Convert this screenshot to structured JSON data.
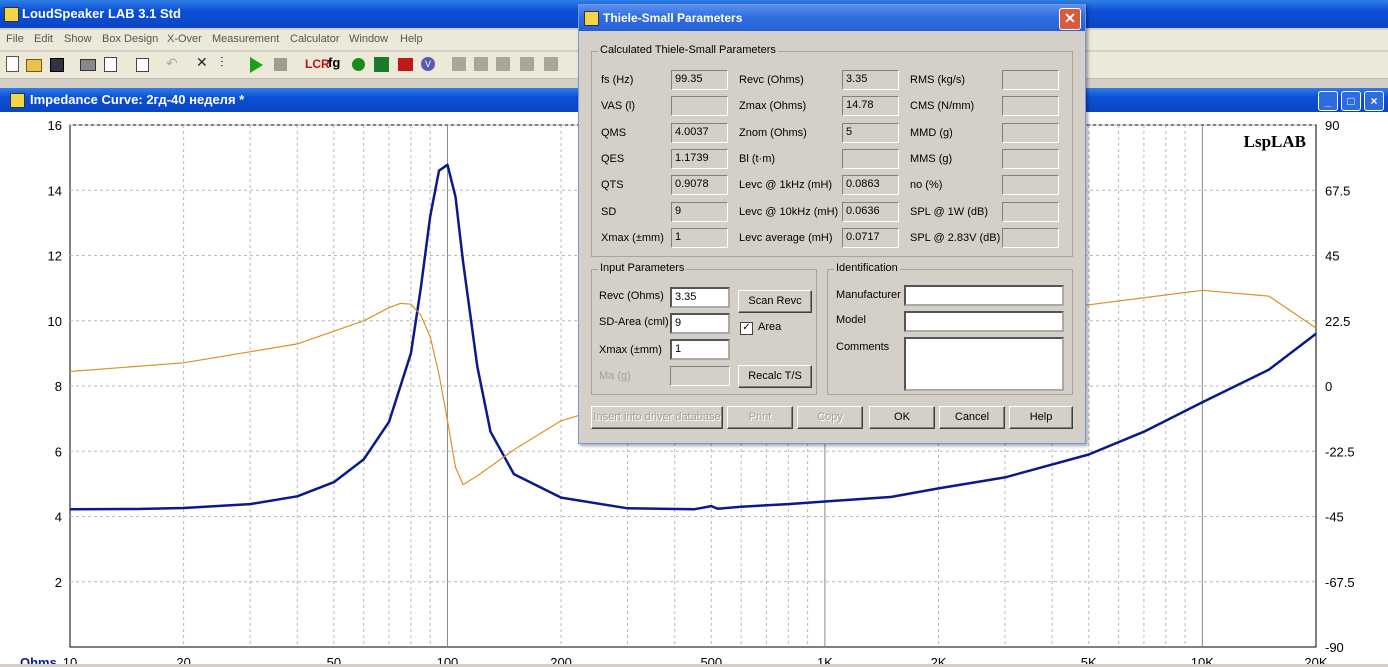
{
  "app": {
    "title": "LoudSpeaker LAB 3.1 Std"
  },
  "menu": [
    "File",
    "Edit",
    "Show",
    "Box Design",
    "X-Over",
    "Measurement",
    "Calculator",
    "Window",
    "Help"
  ],
  "child": {
    "title": "Impedance Curve: 2гд-40 неделя *"
  },
  "chart_data": {
    "type": "line",
    "watermark": "LspLAB",
    "x_scale": "log",
    "xlim": [
      10,
      20000
    ],
    "x_ticks": [
      "10",
      "20",
      "50",
      "100",
      "200",
      "500",
      "1K",
      "2K",
      "5K",
      "10K",
      "20K"
    ],
    "ylim": [
      0,
      16
    ],
    "y_ticks": [
      "16",
      "14",
      "12",
      "10",
      "8",
      "6",
      "4",
      "2"
    ],
    "y2lim": [
      -90,
      90
    ],
    "y2_ticks": [
      "90",
      "67.5",
      "45",
      "22.5",
      "0",
      "-22.5",
      "-45",
      "-67.5",
      "-90"
    ],
    "ylabel": "Ohms",
    "series": [
      {
        "color": "#0a1a8c",
        "axis": "left",
        "x": [
          10,
          15,
          20,
          30,
          40,
          50,
          60,
          70,
          80,
          85,
          90,
          95,
          100,
          105,
          110,
          120,
          130,
          150,
          200,
          300,
          450,
          500,
          520,
          600,
          800,
          1000,
          1500,
          2000,
          3000,
          5000,
          7000,
          10000,
          15000,
          20000
        ],
        "y": [
          4.22,
          4.23,
          4.26,
          4.38,
          4.62,
          5.05,
          5.75,
          6.9,
          9.0,
          11.0,
          13.2,
          14.6,
          14.78,
          13.8,
          11.8,
          8.6,
          6.6,
          5.3,
          4.58,
          4.25,
          4.22,
          4.32,
          4.24,
          4.3,
          4.38,
          4.46,
          4.6,
          4.86,
          5.2,
          5.9,
          6.6,
          7.5,
          8.5,
          9.6
        ]
      },
      {
        "color": "#d69524",
        "axis": "right",
        "x": [
          10,
          20,
          40,
          60,
          70,
          75,
          80,
          85,
          90,
          95,
          100,
          105,
          110,
          120,
          150,
          200,
          300,
          500,
          1000,
          2000,
          5000,
          10000,
          15000,
          20000
        ],
        "y": [
          5,
          8,
          14.5,
          22.5,
          27,
          28.5,
          28.2,
          24.5,
          17,
          4,
          -12,
          -28,
          -34,
          -31,
          -22,
          -12,
          -5,
          0,
          10,
          20,
          28,
          33,
          31,
          20
        ]
      }
    ]
  },
  "dialog": {
    "title": "Thiele-Small Parameters",
    "calc_group": "Calculated Thiele-Small Parameters",
    "calc_rows": [
      [
        {
          "label": "fs (Hz)",
          "value": "99.35"
        },
        {
          "label": "Revc (Ohms)",
          "value": "3.35"
        },
        {
          "label": "RMS (kg/s)",
          "value": ""
        }
      ],
      [
        {
          "label": "VAS (l)",
          "value": ""
        },
        {
          "label": "Zmax (Ohms)",
          "value": "14.78"
        },
        {
          "label": "CMS (N/mm)",
          "value": ""
        }
      ],
      [
        {
          "label": "QMS",
          "value": "4.0037"
        },
        {
          "label": "Znom (Ohms)",
          "value": "5"
        },
        {
          "label": "MMD (g)",
          "value": ""
        }
      ],
      [
        {
          "label": "QES",
          "value": "1.1739"
        },
        {
          "label": "Bl (t·m)",
          "value": ""
        },
        {
          "label": "MMS (g)",
          "value": ""
        }
      ],
      [
        {
          "label": "QTS",
          "value": "0.9078"
        },
        {
          "label": "Levc @ 1kHz (mH)",
          "value": "0.0863"
        },
        {
          "label": "no (%)",
          "value": ""
        }
      ],
      [
        {
          "label": "SD",
          "value": "9"
        },
        {
          "label": "Levc @ 10kHz (mH)",
          "value": "0.0636"
        },
        {
          "label": "SPL @ 1W (dB)",
          "value": ""
        }
      ],
      [
        {
          "label": "Xmax (±mm)",
          "value": "1"
        },
        {
          "label": "Levc average (mH)",
          "value": "0.0717"
        },
        {
          "label": "SPL @ 2.83V (dB)",
          "value": ""
        }
      ]
    ],
    "input_group": "Input Parameters",
    "inputs": [
      {
        "label": "Revc (Ohms)",
        "value": "3.35"
      },
      {
        "label": "SD-Area (cml)",
        "value": "9"
      },
      {
        "label": "Xmax (±mm)",
        "value": "1"
      },
      {
        "label": "Ma (g)",
        "value": ""
      }
    ],
    "scan_revc": "Scan Revc",
    "area_label": "Area",
    "area_checked": true,
    "recalc": "Recalc T/S",
    "ident_group": "Identification",
    "manufacturer_label": "Manufacturer",
    "model_label": "Model",
    "comments_label": "Comments",
    "buttons": {
      "insert": "Insert into driver database",
      "print": "Print",
      "copy": "Copy",
      "ok": "OK",
      "cancel": "Cancel",
      "help": "Help"
    }
  }
}
